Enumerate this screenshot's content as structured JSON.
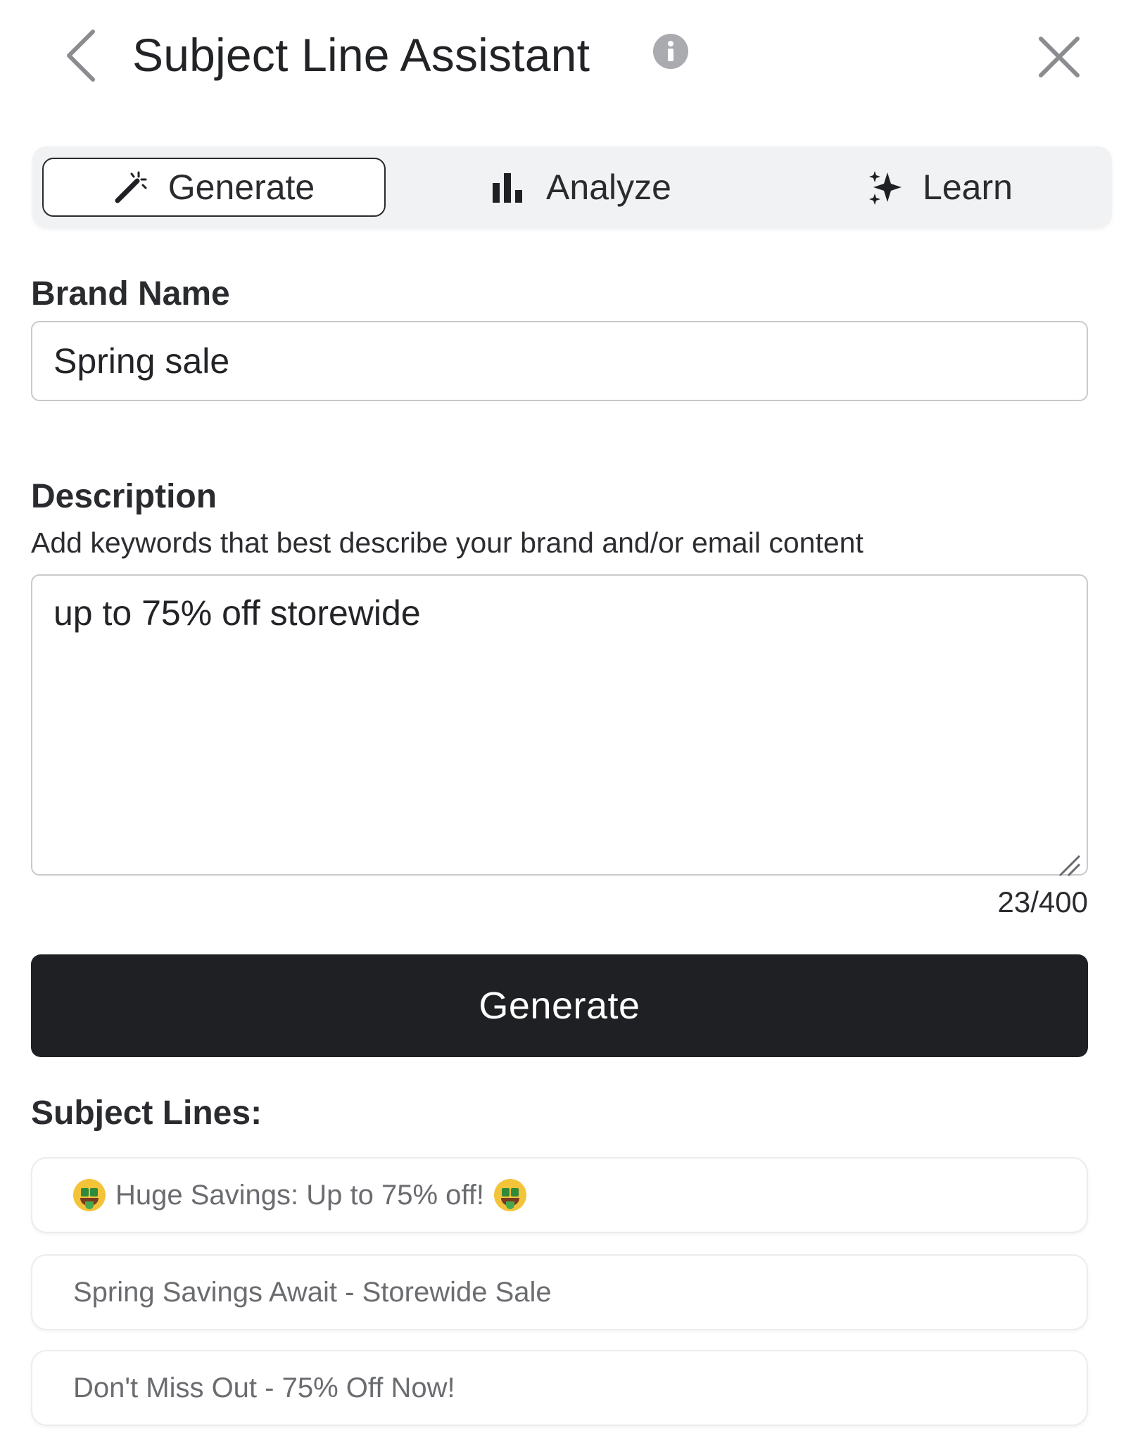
{
  "header": {
    "title": "Subject Line Assistant",
    "back_icon": "chevron-left-icon",
    "info_icon": "info-icon",
    "close_icon": "close-icon"
  },
  "tabs": [
    {
      "label": "Generate",
      "icon": "magic-wand-icon",
      "selected": true
    },
    {
      "label": "Analyze",
      "icon": "bar-chart-icon",
      "selected": false
    },
    {
      "label": "Learn",
      "icon": "sparkle-icon",
      "selected": false
    }
  ],
  "brand": {
    "label": "Brand Name",
    "value": "Spring sale"
  },
  "description": {
    "label": "Description",
    "helper": "Add keywords that best describe your brand and/or email content",
    "value": "up to 75% off storewide",
    "counter": "23/400"
  },
  "generate_button": {
    "label": "Generate"
  },
  "results": {
    "heading": "Subject Lines:",
    "items": [
      {
        "text": "Huge Savings: Up to 75% off!",
        "emoji": "money-mouth-face-icon"
      },
      {
        "text": "Spring Savings Await - Storewide Sale"
      },
      {
        "text": "Don't Miss Out - 75% Off Now!"
      }
    ]
  },
  "colors": {
    "primary_button_bg": "#1f2023",
    "tabbar_bg": "#f1f2f3",
    "text": "#222326",
    "muted_text": "#6a6c70"
  }
}
